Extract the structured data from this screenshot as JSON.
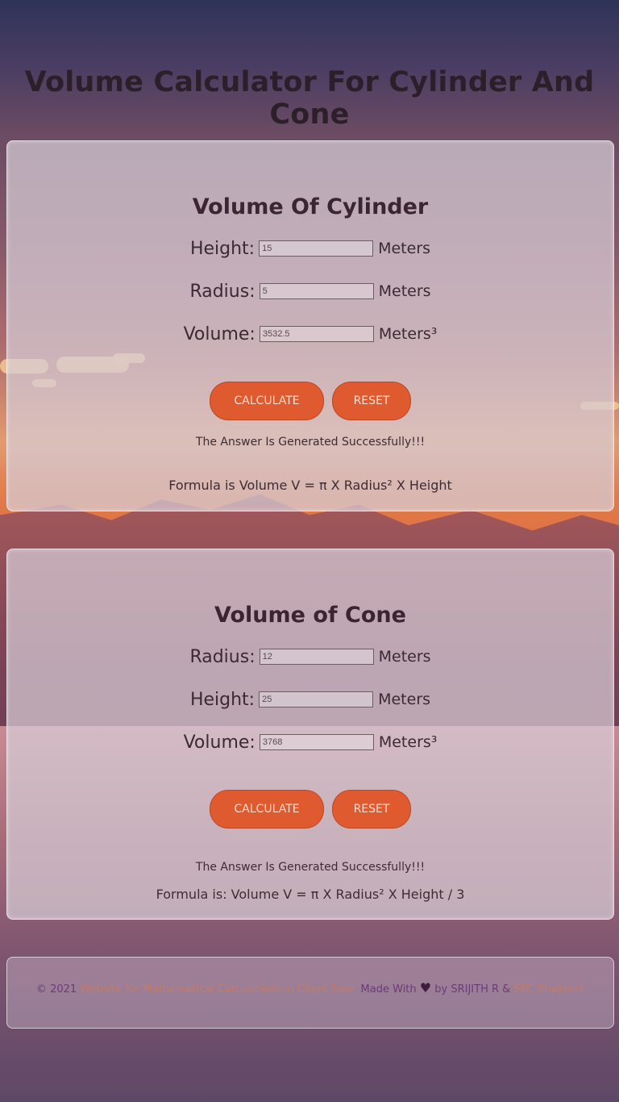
{
  "page": {
    "title": "Volume Calculator For Cylinder And Cone"
  },
  "cylinder": {
    "heading": "Volume Of Cylinder",
    "height_label": "Height:",
    "height_value": "15",
    "radius_label": "Radius:",
    "radius_value": "5",
    "volume_label": "Volume:",
    "volume_value": "3532.5",
    "unit": "Meters",
    "volume_unit": "Meters³",
    "calculate_label": "CALCULATE",
    "reset_label": "RESET",
    "message": "The Answer Is Generated Successfully!!!",
    "formula": "Formula is Volume V = π X Radius² X Height"
  },
  "cone": {
    "heading": "Volume of Cone",
    "radius_label": "Radius:",
    "radius_value": "12",
    "height_label": "Height:",
    "height_value": "25",
    "volume_label": "Volume:",
    "volume_value": "3768",
    "unit": "Meters",
    "volume_unit": "Meters³",
    "calculate_label": "CALCULATE",
    "reset_label": "RESET",
    "message": "The Answer Is Generated Successfully!!!",
    "formula": "Formula is: Volume V = π X Radius² X Height / 3"
  },
  "footer": {
    "copyright": "© 2021 ",
    "site_link": "Website for Mathematical Calculations in Client Side.",
    "made_with": " Made With ",
    "heart": "♥",
    "by": " by SRIJITH R & ",
    "org_link": "SEC",
    "students": " Students"
  },
  "colors": {
    "button": "#df5a2f",
    "heading": "#2d1f2a",
    "footer_text": "#6c3a7a",
    "footer_link": "#c77a63"
  }
}
